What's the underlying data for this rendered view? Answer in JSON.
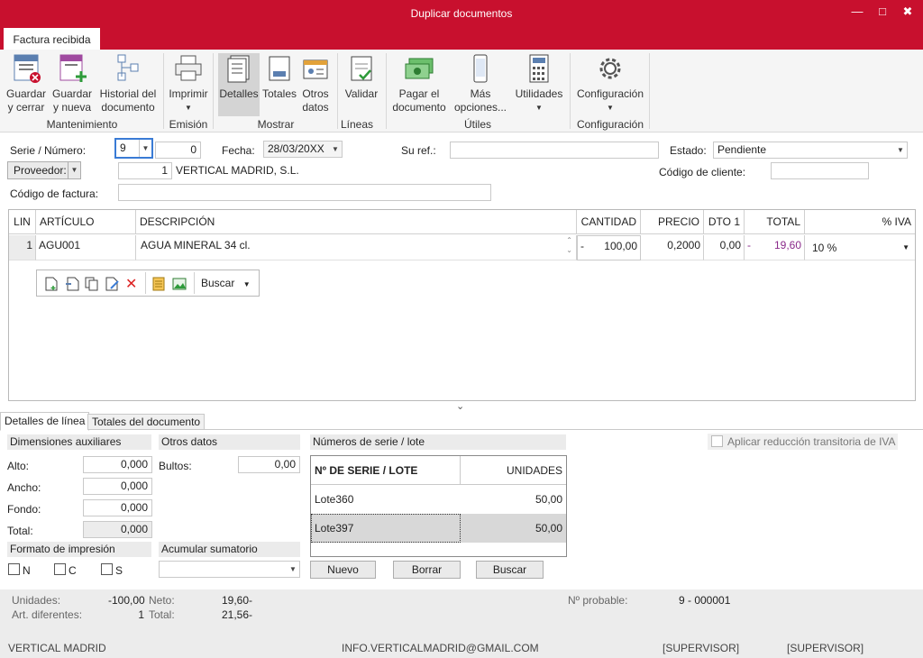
{
  "window": {
    "title": "Duplicar documentos",
    "minimize": "—",
    "maximize": "□",
    "close": "✖"
  },
  "ribbon": {
    "tab": "Factura recibida",
    "buttons": {
      "save_close": "Guardar\ny cerrar",
      "save_new": "Guardar\ny nueva",
      "history": "Historial del\ndocumento",
      "print": "Imprimir",
      "details": "Detalles",
      "totals": "Totales",
      "other": "Otros\ndatos",
      "validate": "Validar",
      "pay": "Pagar el\ndocumento",
      "more": "Más\nopciones...",
      "utilities": "Utilidades",
      "config": "Configuración"
    },
    "groups": {
      "mantenimiento": "Mantenimiento",
      "emision": "Emisión",
      "mostrar": "Mostrar",
      "lineas": "Líneas",
      "utiles": "Útiles",
      "configuracion": "Configuración"
    }
  },
  "form": {
    "serie_label": "Serie / Número:",
    "serie": "9",
    "numero": "0",
    "fecha_label": "Fecha:",
    "fecha": "28/03/20XX",
    "suref_label": "Su ref.:",
    "suref": "",
    "estado_label": "Estado:",
    "estado": "Pendiente",
    "proveedor_button": "Proveedor:",
    "proveedor_code": "1",
    "proveedor_name": "VERTICAL MADRID, S.L.",
    "codigo_cliente_label": "Código de cliente:",
    "codigo_cliente": "",
    "codigo_factura_label": "Código de factura:",
    "codigo_factura": ""
  },
  "grid": {
    "headers": {
      "lin": "LIN",
      "articulo": "ARTÍCULO",
      "descripcion": "DESCRIPCIÓN",
      "cantidad": "CANTIDAD",
      "precio": "PRECIO",
      "dto": "DTO 1",
      "total": "TOTAL",
      "iva": "% IVA"
    },
    "rows": [
      {
        "lin": "1",
        "articulo": "AGU001",
        "descripcion": "AGUA MINERAL 34 cl.",
        "cantidad_sign": "-",
        "cantidad": "100,00",
        "precio": "0,2000",
        "dto": "0,00",
        "total_sign": "-",
        "total": "19,60",
        "iva": "10 %"
      }
    ],
    "toolbar_search": "Buscar"
  },
  "tabs": {
    "detalles": "Detalles de línea",
    "totales": "Totales del documento"
  },
  "dimensiones": {
    "title": "Dimensiones auxiliares",
    "alto_label": "Alto:",
    "alto": "0,000",
    "ancho_label": "Ancho:",
    "ancho": "0,000",
    "fondo_label": "Fondo:",
    "fondo": "0,000",
    "total_label": "Total:",
    "total": "0,000"
  },
  "otros": {
    "title": "Otros datos",
    "bultos_label": "Bultos:",
    "bultos": "0,00"
  },
  "formato": {
    "title": "Formato de impresión",
    "n": "N",
    "c": "C",
    "s": "S"
  },
  "acumular": {
    "title": "Acumular sumatorio",
    "value": ""
  },
  "series": {
    "title": "Números de serie / lote",
    "col1": "Nº DE SERIE / LOTE",
    "col2": "UNIDADES",
    "rows": [
      {
        "lote": "Lote360",
        "unidades": "50,00"
      },
      {
        "lote": "Lote397",
        "unidades": "50,00"
      }
    ],
    "nuevo": "Nuevo",
    "borrar": "Borrar",
    "buscar": "Buscar"
  },
  "reduccion": "Aplicar reducción transitoria de IVA",
  "summary": {
    "unidades_label": "Unidades:",
    "unidades": "-100,00",
    "art_label": "Art. diferentes:",
    "art": "1",
    "neto_label": "Neto:",
    "neto": "19,60-",
    "total_label": "Total:",
    "total": "21,56-",
    "probable_label": "Nº probable:",
    "probable": "9 - 000001"
  },
  "status": {
    "company": "VERTICAL MADRID",
    "email": "INFO.VERTICALMADRID@GMAIL.COM",
    "user1": "[SUPERVISOR]",
    "user2": "[SUPERVISOR]"
  },
  "colors": {
    "accent": "#c8102e",
    "selected": "#d4d4d4"
  }
}
